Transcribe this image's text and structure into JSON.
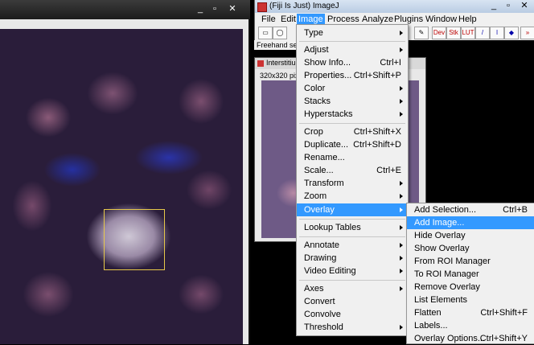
{
  "left_window": {
    "buttons": {
      "minimize": "_",
      "maximize": "▫",
      "close": "✕"
    }
  },
  "fiji": {
    "title": "(Fiji Is Just) ImageJ",
    "menubar": [
      "File",
      "Edit",
      "Image",
      "Process",
      "Analyze",
      "Plugins",
      "Window",
      "Help"
    ],
    "toolbar": {
      "dev": "Dev",
      "stk": "Stk",
      "lut": "LUT"
    },
    "status": "Freehand sele",
    "window_buttons": {
      "minimize": "_",
      "maximize": "▫",
      "close": "✕"
    }
  },
  "second_window": {
    "title": "Interstitiu",
    "info": "320x320 pixe",
    "buttons": {
      "minimize": "_",
      "maximize": "▫",
      "close": "✕"
    }
  },
  "image_menu": {
    "items": [
      {
        "label": "Type",
        "shortcut": "",
        "submenu": true
      },
      {
        "label": "Adjust",
        "shortcut": "",
        "submenu": true
      },
      {
        "label": "Show Info...",
        "shortcut": "Ctrl+I",
        "submenu": false
      },
      {
        "label": "Properties...",
        "shortcut": "Ctrl+Shift+P",
        "submenu": false
      },
      {
        "label": "Color",
        "shortcut": "",
        "submenu": true
      },
      {
        "label": "Stacks",
        "shortcut": "",
        "submenu": true
      },
      {
        "label": "Hyperstacks",
        "shortcut": "",
        "submenu": true
      },
      {
        "label": "Crop",
        "shortcut": "Ctrl+Shift+X",
        "submenu": false
      },
      {
        "label": "Duplicate...",
        "shortcut": "Ctrl+Shift+D",
        "submenu": false
      },
      {
        "label": "Rename...",
        "shortcut": "",
        "submenu": false
      },
      {
        "label": "Scale...",
        "shortcut": "Ctrl+E",
        "submenu": false
      },
      {
        "label": "Transform",
        "shortcut": "",
        "submenu": true
      },
      {
        "label": "Zoom",
        "shortcut": "",
        "submenu": true
      },
      {
        "label": "Overlay",
        "shortcut": "",
        "submenu": true
      },
      {
        "label": "Lookup Tables",
        "shortcut": "",
        "submenu": true
      },
      {
        "label": "Annotate",
        "shortcut": "",
        "submenu": true
      },
      {
        "label": "Drawing",
        "shortcut": "",
        "submenu": true
      },
      {
        "label": "Video Editing",
        "shortcut": "",
        "submenu": true
      },
      {
        "label": "Axes",
        "shortcut": "",
        "submenu": true
      },
      {
        "label": "Convert",
        "shortcut": "",
        "submenu": false
      },
      {
        "label": "Convolve",
        "shortcut": "",
        "submenu": false
      },
      {
        "label": "Threshold",
        "shortcut": "",
        "submenu": true
      }
    ],
    "selected": "Overlay"
  },
  "overlay_menu": {
    "items": [
      {
        "label": "Add Selection...",
        "shortcut": "Ctrl+B"
      },
      {
        "label": "Add Image...",
        "shortcut": ""
      },
      {
        "label": "Hide Overlay",
        "shortcut": ""
      },
      {
        "label": "Show Overlay",
        "shortcut": ""
      },
      {
        "label": "From ROI Manager",
        "shortcut": ""
      },
      {
        "label": "To ROI Manager",
        "shortcut": ""
      },
      {
        "label": "Remove Overlay",
        "shortcut": ""
      },
      {
        "label": "List Elements",
        "shortcut": ""
      },
      {
        "label": "Flatten",
        "shortcut": "Ctrl+Shift+F"
      },
      {
        "label": "Labels...",
        "shortcut": ""
      },
      {
        "label": "Overlay Options...",
        "shortcut": "Ctrl+Shift+Y"
      }
    ],
    "selected": "Add Image..."
  },
  "colors": {
    "accent": "#3399ff",
    "menu_bg": "#f0f0f0",
    "roi": "#e6c84a"
  }
}
